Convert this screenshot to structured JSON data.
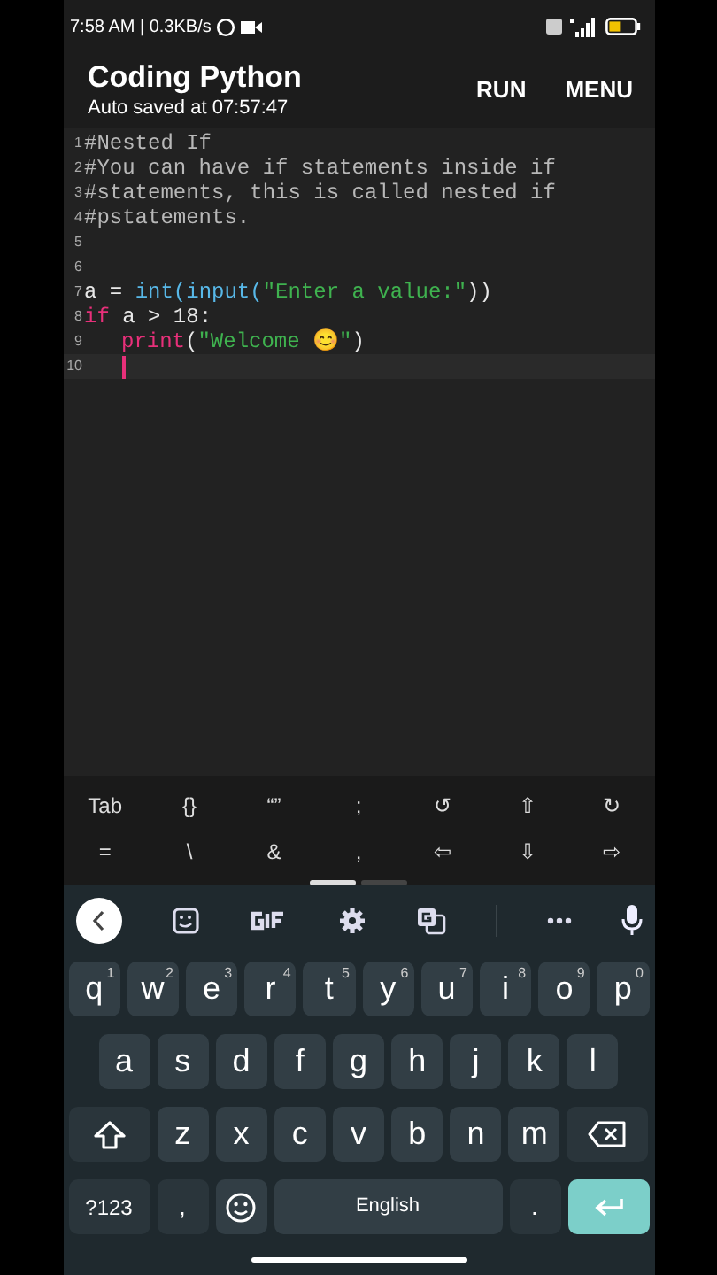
{
  "status_bar": {
    "time_text": "7:58 AM | 0.3KB/s"
  },
  "app_bar": {
    "title": "Coding Python",
    "subtitle": "Auto saved at 07:57:47",
    "actions": [
      "RUN",
      "MENU"
    ]
  },
  "editor": {
    "lines": [
      {
        "number": "1",
        "current": false,
        "tokens": [
          {
            "kind": "comment",
            "text": "#Nested If"
          }
        ]
      },
      {
        "number": "2",
        "current": false,
        "tokens": [
          {
            "kind": "comment",
            "text": "#You can have if statements inside if"
          }
        ]
      },
      {
        "number": "3",
        "current": false,
        "tokens": [
          {
            "kind": "comment",
            "text": "#statements, this is called nested if"
          }
        ]
      },
      {
        "number": "4",
        "current": false,
        "tokens": [
          {
            "kind": "comment",
            "text": "#pstatements."
          }
        ]
      },
      {
        "number": "5",
        "current": false
      },
      {
        "number": "6",
        "current": false
      },
      {
        "number": "7",
        "current": false,
        "tokens": [
          {
            "kind": "plain",
            "text": "a = "
          },
          {
            "kind": "builtin",
            "text": "int(input("
          },
          {
            "kind": "string",
            "text": "\"Enter a value:\""
          },
          {
            "kind": "plain",
            "text": "))"
          }
        ]
      },
      {
        "number": "8",
        "current": false,
        "tokens": [
          {
            "kind": "keyword",
            "text": "if"
          },
          {
            "kind": "plain",
            "text": " a > 18:"
          }
        ]
      },
      {
        "number": "9",
        "current": false,
        "indented": true,
        "tokens": [
          {
            "kind": "keyword",
            "text": "print"
          },
          {
            "kind": "plain",
            "text": "("
          },
          {
            "kind": "string",
            "text": "\"Welcome 😊\""
          },
          {
            "kind": "plain",
            "text": ")"
          }
        ]
      },
      {
        "number": "10",
        "current": true,
        "indented": true
      }
    ]
  },
  "extra_keys": [
    [
      "Tab",
      "{}",
      "“”",
      ";",
      "↺",
      "⇧",
      "↻"
    ],
    [
      "=",
      "\\",
      "&",
      ",",
      "⇦",
      "⇩",
      "⇨"
    ]
  ],
  "pager": [
    {
      "selected": true
    },
    {
      "selected": false
    }
  ],
  "keyboard": {
    "rows": [
      [
        {
          "key": "q",
          "hint": "1"
        },
        {
          "key": "w",
          "hint": "2"
        },
        {
          "key": "e",
          "hint": "3"
        },
        {
          "key": "r",
          "hint": "4"
        },
        {
          "key": "t",
          "hint": "5"
        },
        {
          "key": "y",
          "hint": "6"
        },
        {
          "key": "u",
          "hint": "7"
        },
        {
          "key": "i",
          "hint": "8"
        },
        {
          "key": "o",
          "hint": "9"
        },
        {
          "key": "p",
          "hint": "0"
        }
      ],
      [
        {
          "key": "a"
        },
        {
          "key": "s"
        },
        {
          "key": "d"
        },
        {
          "key": "f"
        },
        {
          "key": "g"
        },
        {
          "key": "h"
        },
        {
          "key": "j"
        },
        {
          "key": "k"
        },
        {
          "key": "l"
        }
      ],
      [
        {
          "key": "z"
        },
        {
          "key": "x"
        },
        {
          "key": "c"
        },
        {
          "key": "v"
        },
        {
          "key": "b"
        },
        {
          "key": "n"
        },
        {
          "key": "m"
        }
      ]
    ],
    "symbols_key": "?123",
    "comma_key": ",",
    "space_key": "English",
    "period_key": "."
  }
}
